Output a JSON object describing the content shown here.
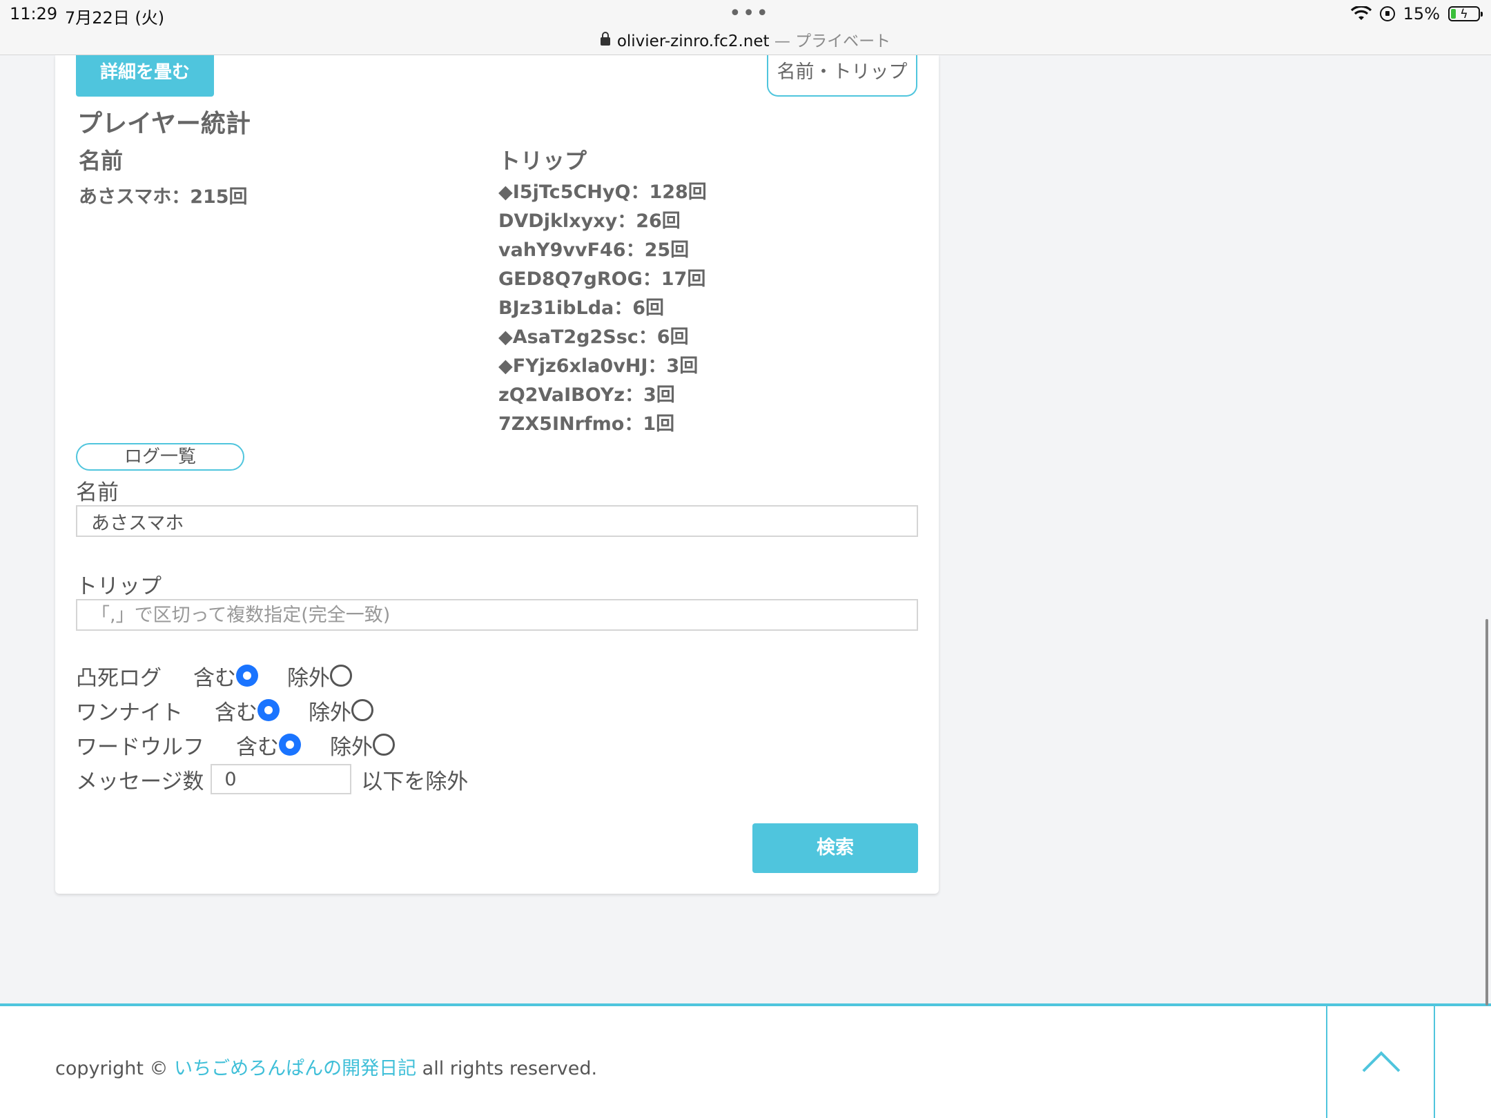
{
  "status_bar": {
    "time": "11:29",
    "date": "7月22日 (火)",
    "dots": "•••",
    "url": "olivier-zinro.fc2.net",
    "url_suffix": " — プライベート",
    "battery": "15%"
  },
  "toolbar": {
    "collapse_label": "詳細を畳む",
    "name_trip_label": "名前・トリップ"
  },
  "stats": {
    "title": "プレイヤー統計",
    "name_header": "名前",
    "trip_header": "トリップ",
    "names": [
      "あさスマホ：215回"
    ],
    "trips": [
      "◆I5jTc5CHyQ：128回",
      "DVDjklxyxy：26回",
      "vahY9vvF46：25回",
      "GED8Q7gROG：17回",
      "BJz31ibLda：6回",
      "◆AsaT2g2Ssc：6回",
      "◆FYjz6xla0vHJ：3回",
      "zQ2VaIBOYz：3回",
      "7ZX5INrfmo：1回"
    ]
  },
  "search_form": {
    "log_list_label": "ログ一覧",
    "name_label": "名前",
    "name_value": "あさスマホ",
    "trip_label": "トリップ",
    "trip_placeholder": "「,」で区切って複数指定(完全一致)",
    "options": [
      {
        "label": "凸死ログ",
        "include": "含む",
        "exclude": "除外",
        "selected": "include"
      },
      {
        "label": "ワンナイト",
        "include": "含む",
        "exclude": "除外",
        "selected": "include"
      },
      {
        "label": "ワードウルフ",
        "include": "含む",
        "exclude": "除外",
        "selected": "include"
      }
    ],
    "message_label": "メッセージ数",
    "message_value": "0",
    "message_suffix": "以下を除外",
    "search_label": "検索"
  },
  "footer": {
    "copyright_prefix": "copyright © ",
    "site_link": "いちごめろんぱんの開発日記",
    "copyright_suffix": " all rights reserved."
  },
  "colors": {
    "accent": "#4fc5dd",
    "radio_selected": "#1a74ff",
    "page_bg": "#f3f4f6"
  }
}
